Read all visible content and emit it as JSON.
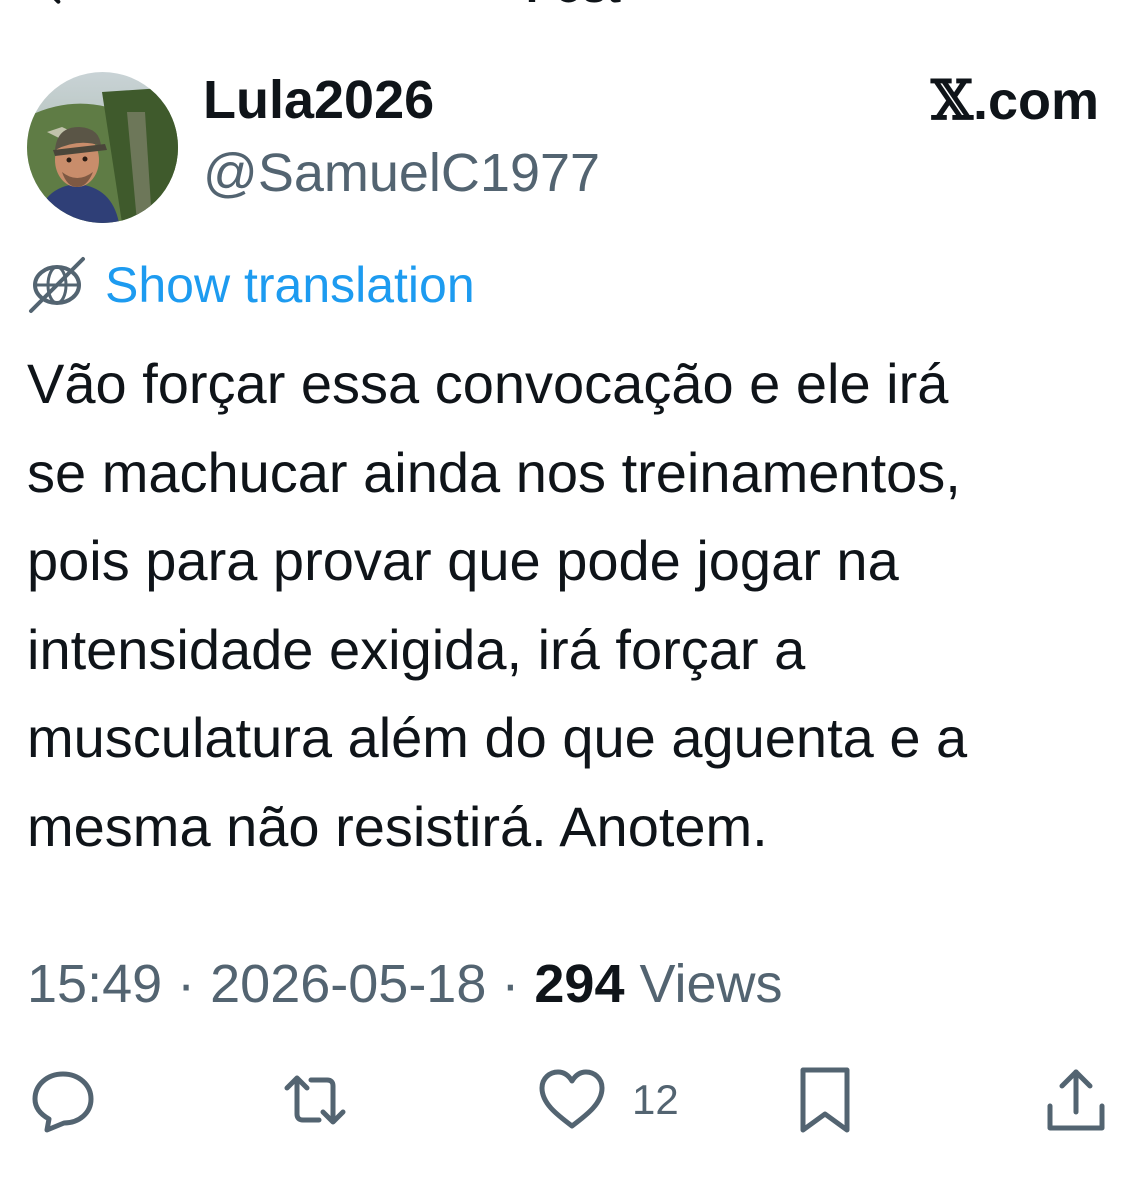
{
  "header": {
    "title": "Post",
    "back_icon": "arrow-left-icon"
  },
  "author": {
    "display_name": "Lula2026",
    "handle": "@SamuelC1977"
  },
  "watermark": {
    "mark": "𝕏",
    "suffix": ".com"
  },
  "translation": {
    "label": "Show translation",
    "icon": "translate-globe-icon"
  },
  "tweet": {
    "text": "Vão forçar essa convocação e ele irá\nse machucar ainda nos treinamentos,\npois para provar que pode jogar na\nintensidade exigida, irá forçar a\nmusculatura além do que aguenta e a\nmesma não resistirá. Anotem."
  },
  "meta": {
    "time": "15:49",
    "separator": " · ",
    "date": "2026-05-18",
    "views_count": "294",
    "views_label": " Views"
  },
  "actions": {
    "reply_icon": "reply-icon",
    "retweet_icon": "retweet-icon",
    "like_icon": "heart-icon",
    "like_count": "12",
    "bookmark_icon": "bookmark-icon",
    "share_icon": "share-icon"
  },
  "colors": {
    "text": "#0f1419",
    "secondary": "#536471",
    "accent": "#1d9bf0",
    "background": "#ffffff"
  }
}
